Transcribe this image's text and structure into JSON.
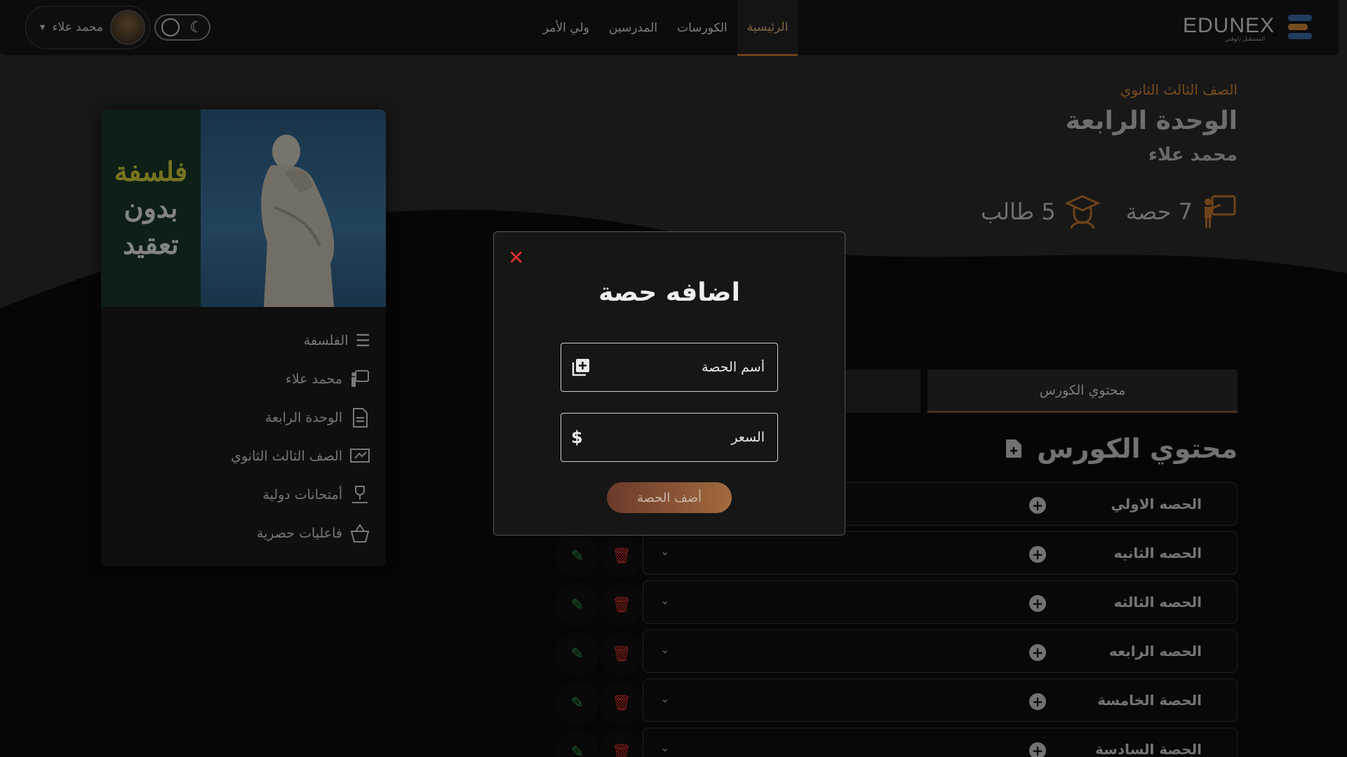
{
  "brand": {
    "name": "EDUNEX",
    "tagline": "المستقبل دلوقتي"
  },
  "nav": {
    "links": [
      "الرئيسية",
      "الكورسات",
      "المدرسين",
      "ولي الأمر"
    ],
    "active": "الرئيسية"
  },
  "user": {
    "name": "محمد علاء"
  },
  "course": {
    "grade": "الصف الثالث الثانوي",
    "unit": "الوحدة الرابعة",
    "teacher": "محمد علاء",
    "lessons_count": "7 حصة",
    "students_count": "5 طالب"
  },
  "card": {
    "image_text": [
      "فلسفة",
      "بدون",
      "تعقيد"
    ],
    "items": [
      {
        "icon": "list-icon",
        "label": "الفلسفة"
      },
      {
        "icon": "teacher-icon",
        "label": "محمد علاء"
      },
      {
        "icon": "document-icon",
        "label": "الوحدة الرابعة"
      },
      {
        "icon": "board-icon",
        "label": "الصف الثالث الثانوي"
      },
      {
        "icon": "exam-icon",
        "label": "أمتحانات دولية"
      },
      {
        "icon": "basket-icon",
        "label": "فاعليات حصرية"
      }
    ]
  },
  "tabs": {
    "course_content": "محتوي الكورس"
  },
  "content_heading": "محتوي الكورس",
  "lessons": [
    "الحصه الاولي",
    "الحصه الثانيه",
    "الحصه الثالثه",
    "الحصه الرابعه",
    "الحصة الخامسة",
    "الحصة السادسة"
  ],
  "modal": {
    "title": "اضافه حصة",
    "name_placeholder": "أسم الحصة",
    "price_placeholder": "السعر",
    "submit": "أضف الحصة"
  },
  "colors": {
    "accent": "#d88a35",
    "danger": "#e0322a",
    "edit": "#2fa84f"
  }
}
